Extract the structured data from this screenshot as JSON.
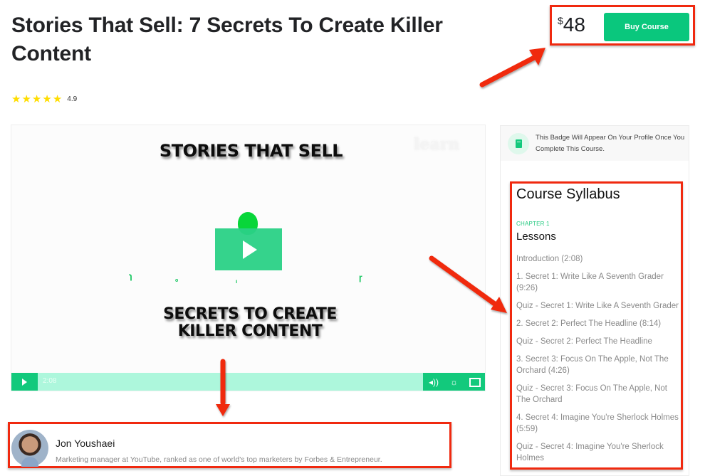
{
  "course": {
    "title": "Stories That Sell: 7 Secrets To Create Killer Content",
    "rating": {
      "stars": 5,
      "value": "4.9"
    }
  },
  "purchase": {
    "currency_symbol": "$",
    "price": "48",
    "buy_label": "Buy Course"
  },
  "video": {
    "overlay_title": "STORIES THAT SELL",
    "overlay_subtitle": "SECRETS TO CREATE KILLER CONTENT",
    "watermark": "learn",
    "duration": "2:08",
    "progress": 0,
    "controls": {
      "play_icon": "play-icon",
      "volume_icon": "volume-icon",
      "settings_icon": "settings-icon",
      "fullscreen_icon": "fullscreen-icon"
    }
  },
  "instructor": {
    "name": "Jon Youshaei",
    "bio": "Marketing manager at YouTube, ranked as one of world's top marketers by Forbes & Entrepreneur."
  },
  "sidebar": {
    "badge_text": "This Badge Will Appear On Your Profile Once You Complete This Course.",
    "syllabus_title": "Course Syllabus",
    "chapters": [
      {
        "label": "CHAPTER 1",
        "name": "Lessons",
        "lessons": [
          "Introduction (2:08)",
          "1. Secret 1: Write Like A Seventh Grader (9:26)",
          "Quiz - Secret 1: Write Like A Seventh Grader",
          "2. Secret 2: Perfect The Headline (8:14)",
          "Quiz - Secret 2: Perfect The Headline",
          "3. Secret 3: Focus On The Apple, Not The Orchard (4:26)",
          "Quiz - Secret 3: Focus On The Apple, Not The Orchard",
          "4. Secret 4: Imagine You're Sherlock Holmes (5:59)",
          "Quiz - Secret 4: Imagine You're Sherlock Holmes"
        ]
      }
    ]
  },
  "colors": {
    "accent": "#0ac77d",
    "annotation": "#f0290f",
    "star": "#ffdd00"
  }
}
